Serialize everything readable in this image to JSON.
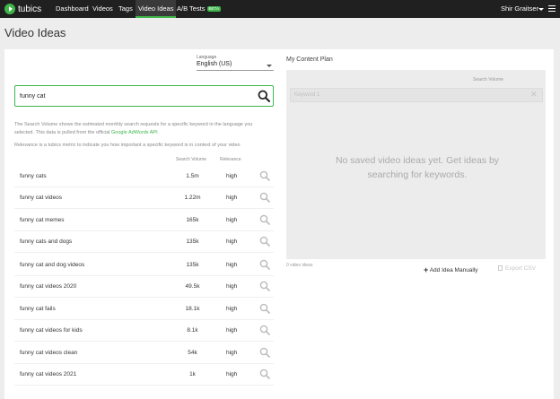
{
  "nav": {
    "logo_text": "tubics",
    "items": [
      {
        "label": "Dashboard"
      },
      {
        "label": "Videos"
      },
      {
        "label": "Tags"
      },
      {
        "label": "Video Ideas"
      },
      {
        "label": "A/B Tests"
      }
    ],
    "beta_label": "BETA",
    "user_name": "Shir Graitser"
  },
  "page_title": "Video Ideas",
  "language": {
    "label": "Language",
    "value": "English (US)"
  },
  "search": {
    "value": "funny cat"
  },
  "info": {
    "line1a": "The Search Volume shows the estimated monthly search requests for a specific keyword in the language you",
    "line1b": "selected. This data is pulled from the official",
    "link": "Google AdWords API",
    "line2": "Relevance is a tubics metric to indicate you how important a specific keyword is in context of your video"
  },
  "table": {
    "columns": {
      "volume": "Search Volume",
      "relevance": "Relevance"
    },
    "rows": [
      {
        "keyword": "funny cats",
        "volume": "1.5m",
        "relevance": "high"
      },
      {
        "keyword": "funny cat videos",
        "volume": "1.22m",
        "relevance": "high"
      },
      {
        "keyword": "funny cat memes",
        "volume": "165k",
        "relevance": "high"
      },
      {
        "keyword": "funny cats and dogs",
        "volume": "135k",
        "relevance": "high"
      },
      {
        "keyword": "funny cat and dog videos",
        "volume": "135k",
        "relevance": "high"
      },
      {
        "keyword": "funny cat videos 2020",
        "volume": "49.5k",
        "relevance": "high"
      },
      {
        "keyword": "funny cat fails",
        "volume": "18.1k",
        "relevance": "high"
      },
      {
        "keyword": "funny cat videos for kids",
        "volume": "8.1k",
        "relevance": "high"
      },
      {
        "keyword": "funny cat videos clean",
        "volume": "54k",
        "relevance": "high"
      },
      {
        "keyword": "funny cat videos 2021",
        "volume": "1k",
        "relevance": "high"
      }
    ]
  },
  "plan": {
    "title": "My Content Plan",
    "search_volume_head": "Search Volume",
    "keyword_placeholder": "Keyword 1",
    "empty_line1": "No saved video ideas yet. Get ideas by",
    "empty_line2": "searching for keywords.",
    "count": "0 video ideas",
    "add_label": "Add Idea Manually",
    "export_label": "Export CSV"
  },
  "colors": {
    "accent": "#3fb54a",
    "topbar": "#202020"
  }
}
